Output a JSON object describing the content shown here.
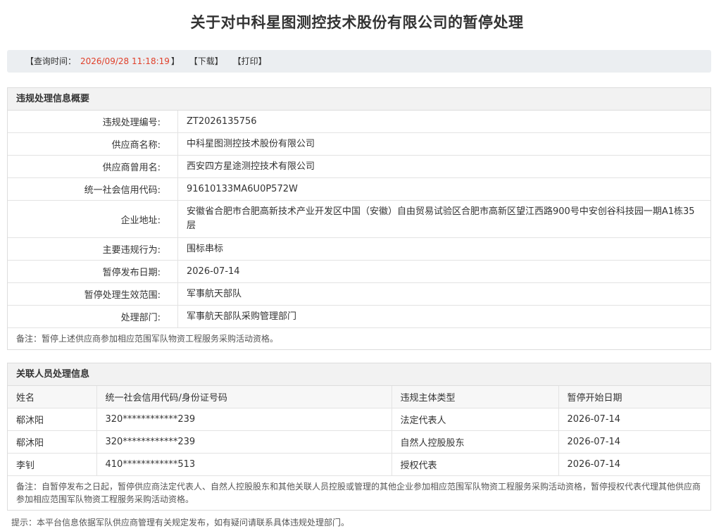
{
  "title": "关于对中科星图测控技术股份有限公司的暂停处理",
  "toolbar": {
    "query_label": "【查询时间：",
    "query_time": "2026/09/28 11:18:19",
    "query_close": "】",
    "download": "【下载】",
    "print": "【打印】"
  },
  "violation": {
    "heading": "违规处理信息概要",
    "rows": [
      {
        "label": "违规处理编号:",
        "value": "ZT2026135756"
      },
      {
        "label": "供应商名称:",
        "value": "中科星图测控技术股份有限公司"
      },
      {
        "label": "供应商曾用名:",
        "value": "西安四方星途测控技术有限公司"
      },
      {
        "label": "统一社会信用代码:",
        "value": "91610133MA6U0P572W"
      },
      {
        "label": "企业地址:",
        "value": "安徽省合肥市合肥高新技术产业开发区中国（安徽）自由贸易试验区合肥市高新区望江西路900号中安创谷科技园一期A1栋35层"
      },
      {
        "label": "主要违规行为:",
        "value": "围标串标"
      },
      {
        "label": "暂停发布日期:",
        "value": "2026-07-14"
      },
      {
        "label": "暂停处理生效范围:",
        "value": "军事航天部队"
      },
      {
        "label": "处理部门:",
        "value": "军事航天部队采购管理部门"
      }
    ],
    "note": "备注：暂停上述供应商参加相应范围军队物资工程服务采购活动资格。"
  },
  "related": {
    "heading": "关联人员处理信息",
    "columns": [
      "姓名",
      "统一社会信用代码/身份证号码",
      "违规主体类型",
      "暂停开始日期"
    ],
    "rows": [
      [
        "郗沐阳",
        "320************239",
        "法定代表人",
        "2026-07-14"
      ],
      [
        "郗沐阳",
        "320************239",
        "自然人控股股东",
        "2026-07-14"
      ],
      [
        "李钊",
        "410************513",
        "授权代表",
        "2026-07-14"
      ]
    ],
    "note": "备注：自暂停发布之日起，暂停供应商法定代表人、自然人控股股东和其他关联人员控股或管理的其他企业参加相应范围军队物资工程服务采购活动资格，暂停授权代表代理其他供应商参加相应范围军队物资工程服务采购活动资格。"
  },
  "footer": "提示：本平台信息依据军队供应商管理有关规定发布，如有疑问请联系具体违规处理部门。",
  "colors": {
    "accent_time": "#e0402a",
    "toolbar_bg": "#ebeef1",
    "panel_head_bg": "#f2f2f2"
  }
}
